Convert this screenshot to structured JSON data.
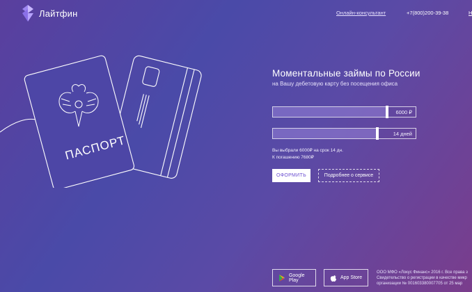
{
  "header": {
    "logo_text": "Лайтфин",
    "consultant_link": "Онлайн-консультант",
    "phone": "+7(800)200-39-38",
    "extra_link": "Н"
  },
  "illustration": {
    "passport_label": "ПАСПОРТ"
  },
  "hero": {
    "title": "Моментальные займы по России",
    "subtitle": "на Вашу дебетовую карту без посещения офиса"
  },
  "amount_slider": {
    "value_label": "6000 ₽",
    "level": 0.8
  },
  "term_slider": {
    "value_label": "14 дней",
    "level": 0.73
  },
  "summary": {
    "line1": "Вы выбрали 6000₽ на срок 14 дн.",
    "line2": "К погашению 7680₽"
  },
  "buttons": {
    "apply": "ОФОРМИТЬ",
    "details": "Подробнее о сервисе"
  },
  "stores": {
    "google": "Google Play",
    "apple": "App Store"
  },
  "legal": {
    "line1": "ООО МФО «Локус Финанс» 2016 г. Все права з",
    "line2": "Свидетельство о регистрации в качестве микр",
    "line3": "организации № 001603380007705 от 25 мар"
  },
  "colors": {
    "accent": "#6b4fd1",
    "background_start": "#5a3f9e",
    "background_end": "#7a3d8c"
  }
}
